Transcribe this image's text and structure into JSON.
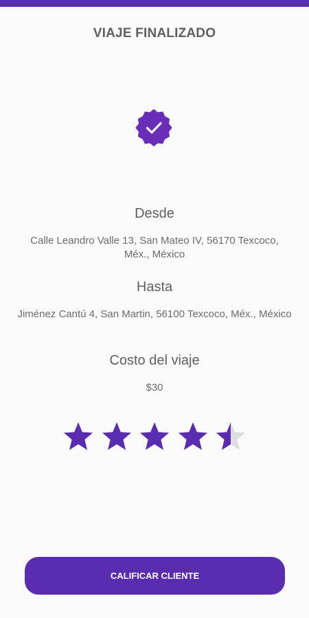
{
  "header": {
    "title": "VIAJE FINALIZADO"
  },
  "badge": {
    "icon": "verified-check-badge-icon",
    "color": "#6A2DB8"
  },
  "trip": {
    "from_label": "Desde",
    "from_address": "Calle Leandro Valle 13, San Mateo IV, 56170 Texcoco, Méx., México",
    "to_label": "Hasta",
    "to_address": "Jiménez Cantú 4, San Martin, 56100 Texcoco, Méx., México",
    "cost_label": "Costo del viaje",
    "cost_value": "$30"
  },
  "rating": {
    "value": 4.5,
    "max": 5,
    "filled_color": "#5A2CB0",
    "empty_color": "#DDDDDD"
  },
  "actions": {
    "rate_button_label": "CALIFICAR CLIENTE"
  },
  "theme": {
    "accent": "#5A2CB0",
    "background": "#FAFAFA"
  }
}
